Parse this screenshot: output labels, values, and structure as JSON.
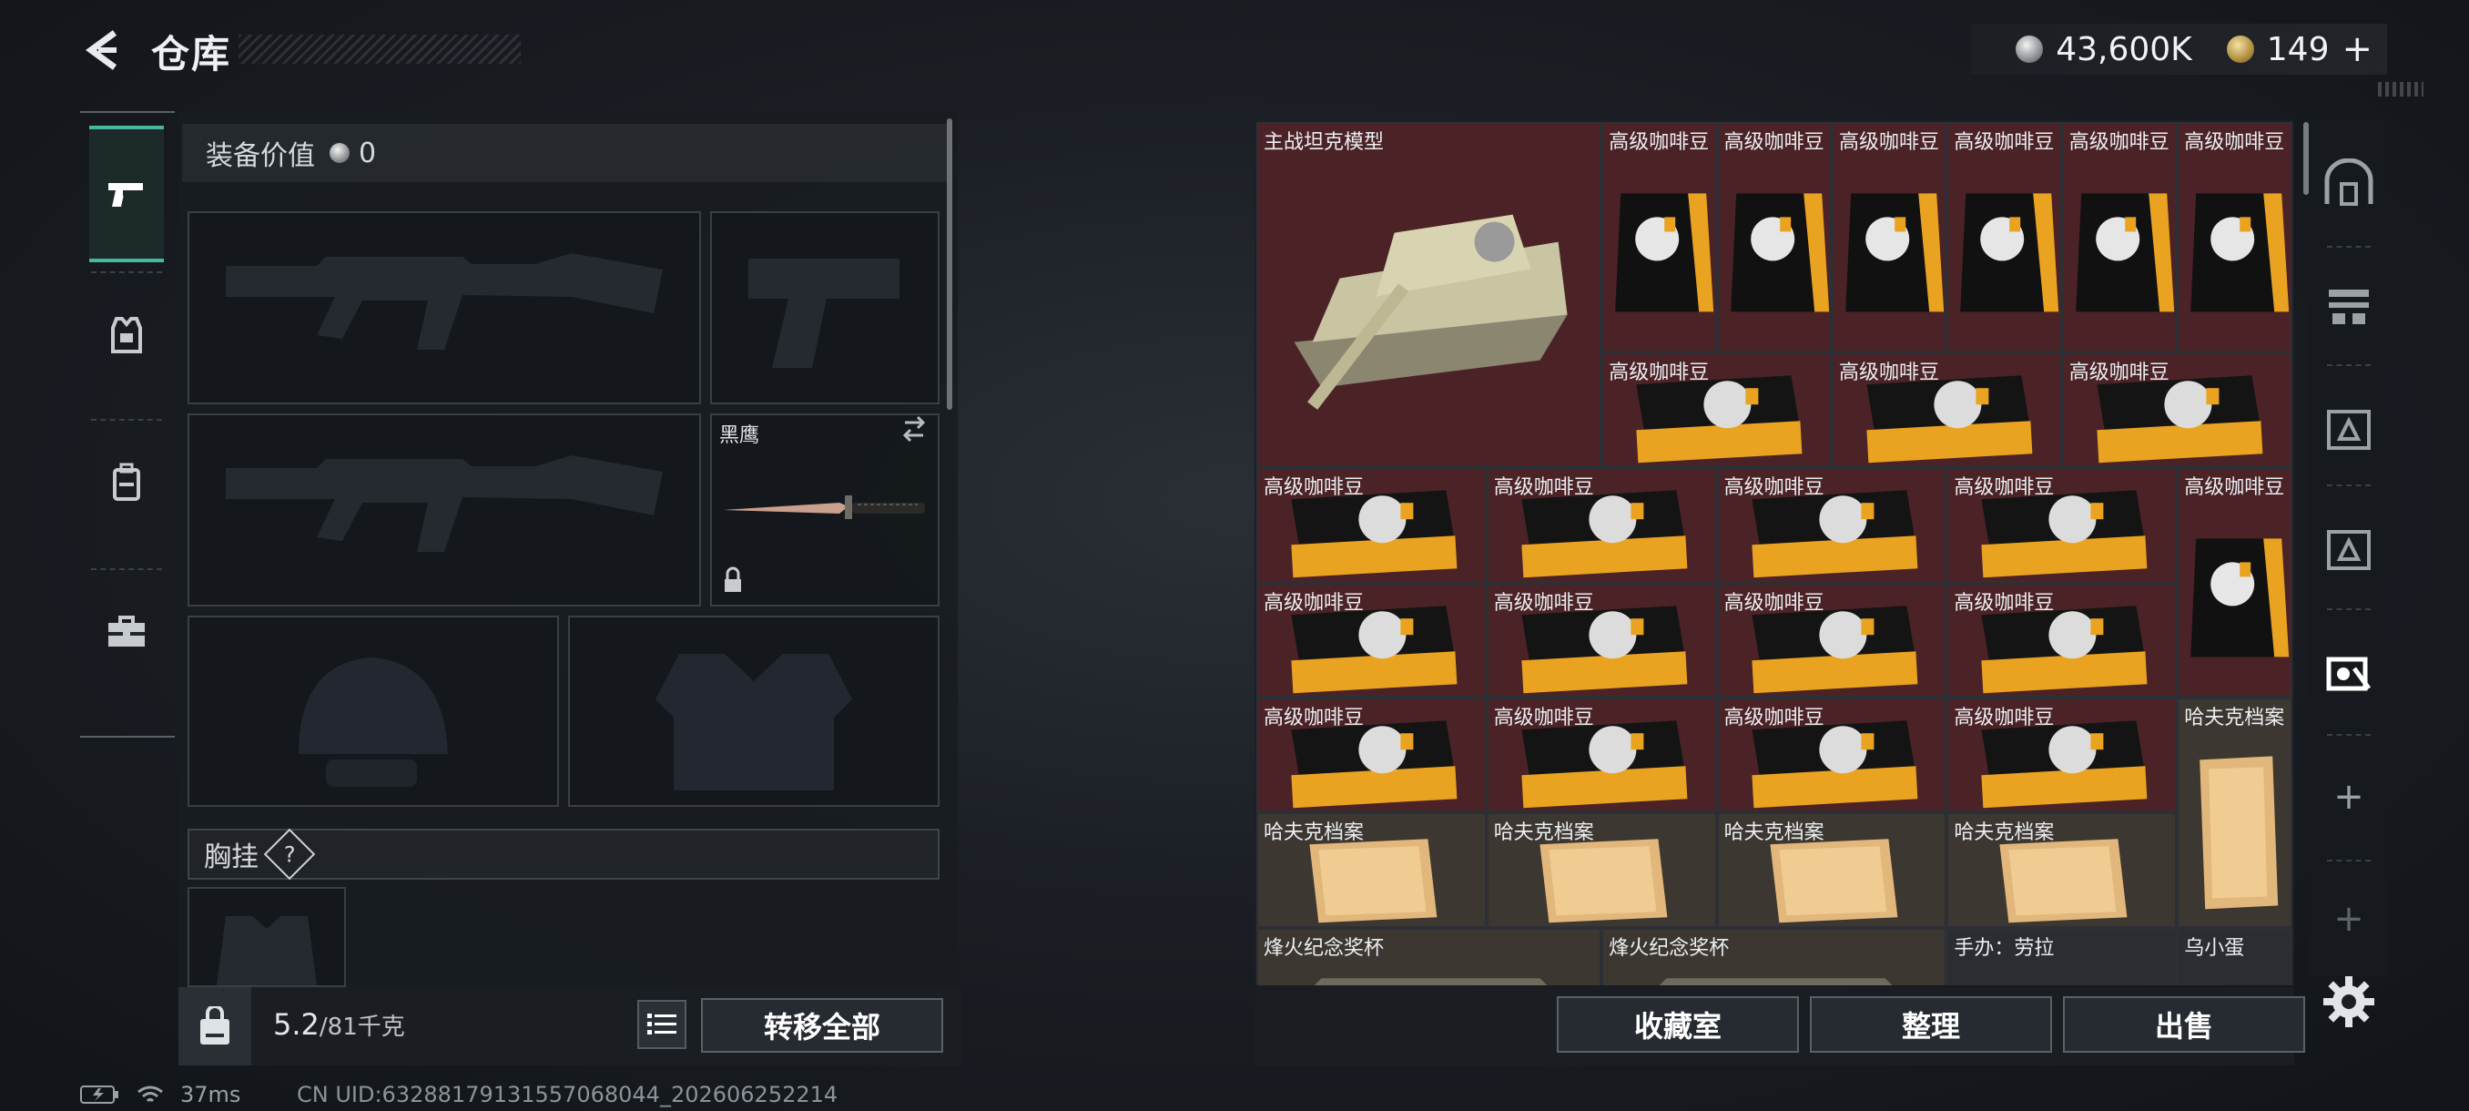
{
  "header": {
    "title": "仓库",
    "currency_1": "43,600K",
    "currency_2": "149",
    "add_label": "+"
  },
  "equipment": {
    "value_label": "装备价值",
    "value_amount": "0",
    "melee_name": "黑鹰",
    "chest_label": "胸挂",
    "help_symbol": "?",
    "weight_current": "5.2",
    "weight_max": "/81千克",
    "transfer_all_label": "转移全部"
  },
  "grid": {
    "items": [
      {
        "label": "主战坦克模型",
        "type": "tank"
      },
      {
        "label": "高级咖啡豆",
        "type": "coffee-bag"
      },
      {
        "label": "高级咖啡豆",
        "type": "coffee-bag"
      },
      {
        "label": "高级咖啡豆",
        "type": "coffee-bag"
      },
      {
        "label": "高级咖啡豆",
        "type": "coffee-bag"
      },
      {
        "label": "高级咖啡豆",
        "type": "coffee-bag"
      },
      {
        "label": "高级咖啡豆",
        "type": "coffee-bag"
      },
      {
        "label": "高级咖啡豆",
        "type": "coffee-flat"
      },
      {
        "label": "高级咖啡豆",
        "type": "coffee-flat"
      },
      {
        "label": "高级咖啡豆",
        "type": "coffee-flat"
      },
      {
        "label": "高级咖啡豆",
        "type": "coffee-flat"
      },
      {
        "label": "高级咖啡豆",
        "type": "coffee-flat"
      },
      {
        "label": "高级咖啡豆",
        "type": "coffee-flat"
      },
      {
        "label": "高级咖啡豆",
        "type": "coffee-flat"
      },
      {
        "label": "高级咖啡豆",
        "type": "coffee-bag"
      },
      {
        "label": "高级咖啡豆",
        "type": "coffee-flat"
      },
      {
        "label": "高级咖啡豆",
        "type": "coffee-flat"
      },
      {
        "label": "高级咖啡豆",
        "type": "coffee-flat"
      },
      {
        "label": "高级咖啡豆",
        "type": "coffee-flat"
      },
      {
        "label": "高级咖啡豆",
        "type": "coffee-flat"
      },
      {
        "label": "高级咖啡豆",
        "type": "coffee-flat"
      },
      {
        "label": "高级咖啡豆",
        "type": "coffee-flat"
      },
      {
        "label": "高级咖啡豆",
        "type": "coffee-flat"
      },
      {
        "label": "哈夫克档案",
        "type": "file-tall"
      },
      {
        "label": "哈夫克档案",
        "type": "file"
      },
      {
        "label": "哈夫克档案",
        "type": "file"
      },
      {
        "label": "哈夫克档案",
        "type": "file"
      },
      {
        "label": "哈夫克档案",
        "type": "file"
      },
      {
        "label": "烽火纪念奖杯",
        "type": "trophy"
      },
      {
        "label": "烽火纪念奖杯",
        "type": "trophy"
      },
      {
        "label": "手办：劳拉",
        "type": "figure"
      },
      {
        "label": "乌小蛋",
        "type": "egg"
      }
    ]
  },
  "actions": {
    "collection_label": "收藏室",
    "sort_label": "整理",
    "sell_label": "出售"
  },
  "status": {
    "ping": "37ms",
    "uid": "CN UID:6328817913155706804​4_202606252214"
  },
  "colors": {
    "accent_teal": "#48b79f",
    "rare_red": "#4b2327",
    "tan": "#3d3731",
    "coffee_orange": "#e9a321"
  }
}
